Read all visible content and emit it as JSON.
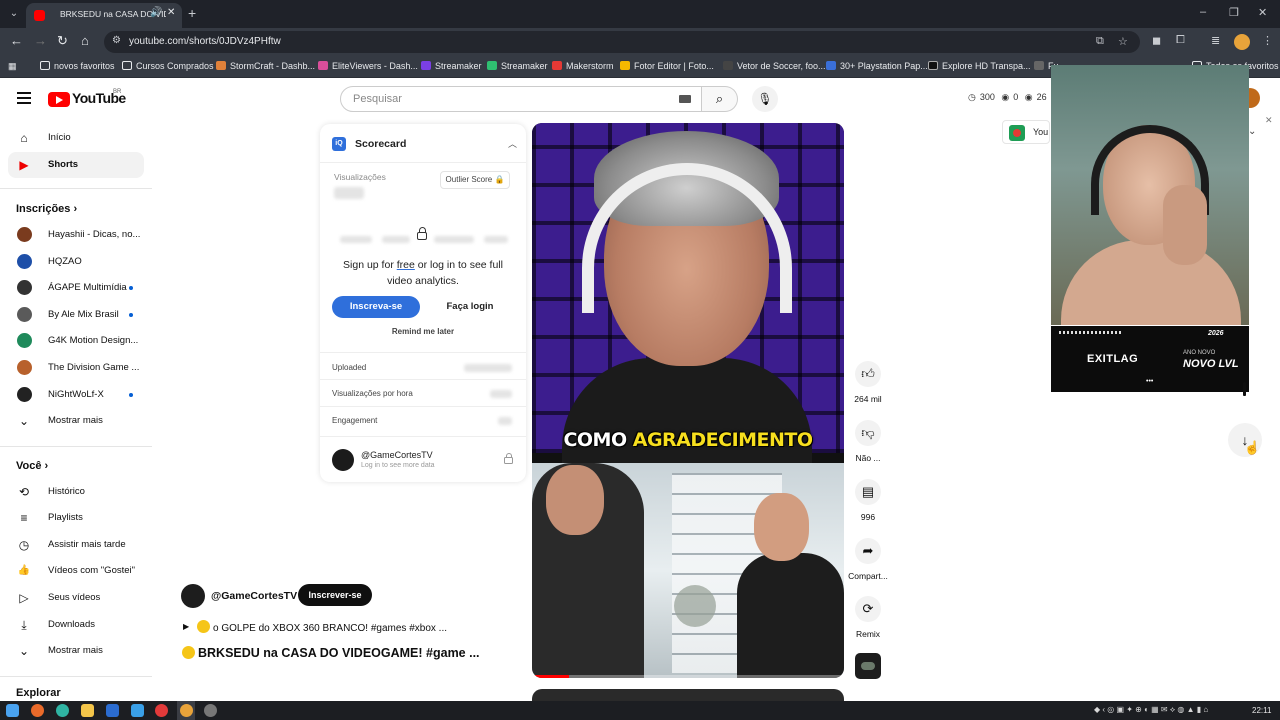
{
  "browser": {
    "tab_title": "BRKSEDU na CASA DO VIDEOGAME!",
    "url": "youtube.com/shorts/0JDVz4PHftw",
    "window_controls": [
      "–",
      "❐",
      "✕"
    ],
    "bookmarks": [
      {
        "label": "novos favoritos",
        "color": "#e8eaed"
      },
      {
        "label": "Cursos Comprados",
        "color": "#e8eaed"
      },
      {
        "label": "StormCraft - Dashb...",
        "color": "#e0813a"
      },
      {
        "label": "EliteViewers - Dash...",
        "color": "#d94e9a"
      },
      {
        "label": "Streamaker",
        "color": "#7b3fe4"
      },
      {
        "label": "Streamaker",
        "color": "#2fbf71"
      },
      {
        "label": "Makerstorm",
        "color": "#e53935"
      },
      {
        "label": "Fotor Editor | Foto...",
        "color": "#f5b800"
      },
      {
        "label": "Vetor de Soccer, foo...",
        "color": "#444444"
      },
      {
        "label": "30+ Playstation Pap...",
        "color": "#3a6fd8"
      },
      {
        "label": "Explore HD Transpa...",
        "color": "#111111"
      },
      {
        "label": "Fu...",
        "color": "#666666"
      },
      {
        "label": "Todos os favoritos",
        "color": "#e8eaed"
      }
    ]
  },
  "masthead": {
    "logo_text": "YouTube",
    "region": "BR",
    "search_placeholder": "Pesquisar",
    "ext_stats": [
      "300",
      "0",
      "26"
    ],
    "ext_widget_label": "You"
  },
  "sidebar": {
    "main": [
      {
        "label": "Início",
        "icon": "home-icon",
        "glyph": "⌂"
      },
      {
        "label": "Shorts",
        "icon": "shorts-icon",
        "glyph": "▶"
      }
    ],
    "subs_heading": "Inscrições",
    "subscriptions": [
      {
        "label": "Hayashii - Dicas, no...",
        "color": "#7a3b1e",
        "dot": false
      },
      {
        "label": "HQZAO",
        "color": "#1e4fa8",
        "dot": false
      },
      {
        "label": "ÁGAPE Multimídia",
        "color": "#333333",
        "dot": true
      },
      {
        "label": "By Ale Mix Brasil",
        "color": "#5a5a5a",
        "dot": true
      },
      {
        "label": "G4K Motion Design...",
        "color": "#1f8a5b",
        "dot": false
      },
      {
        "label": "The Division Game ...",
        "color": "#b8612c",
        "dot": false
      },
      {
        "label": "NiGhtWoLf-X",
        "color": "#222222",
        "dot": true
      }
    ],
    "show_more": "Mostrar mais",
    "you_heading": "Você",
    "you_items": [
      {
        "label": "Histórico",
        "icon": "history-icon",
        "glyph": "⟲"
      },
      {
        "label": "Playlists",
        "icon": "playlists-icon",
        "glyph": "≡"
      },
      {
        "label": "Assistir mais tarde",
        "icon": "watch-later-icon",
        "glyph": "◷"
      },
      {
        "label": "Vídeos com \"Gostei\"",
        "icon": "liked-icon",
        "glyph": "👍"
      },
      {
        "label": "Seus vídeos",
        "icon": "your-videos-icon",
        "glyph": "▷"
      },
      {
        "label": "Downloads",
        "icon": "downloads-icon",
        "glyph": "⤓"
      }
    ],
    "show_more_2": "Mostrar mais",
    "explore_heading": "Explorar"
  },
  "scorecard": {
    "title": "Scorecard",
    "views_label": "Visualizações",
    "outlier_label": "Outlier Score",
    "signup_prefix": "Sign up for ",
    "signup_free": "free",
    "signup_suffix": " or log in to see full video analytics.",
    "subscribe_btn": "Inscreva-se",
    "login_btn": "Faça login",
    "remind": "Remind me later",
    "uploaded_label": "Uploaded",
    "views_hour_label": "Visualizações por hora",
    "engagement_label": "Engagement",
    "channel_name": "@GameCortesTV",
    "channel_sub": "Log in to see more data"
  },
  "video": {
    "caption_a": "COMO ",
    "caption_b": "AGRADECIMENTO",
    "channel": "@GameCortesTV",
    "subscribe": "Inscrever-se",
    "description": "o GOLPE do XBOX 360 BRANCO! #games #xbox ...",
    "title": "BRKSEDU na CASA DO VIDEOGAME! #game ...",
    "progress": 0.12
  },
  "actions": {
    "like_count": "264 mil",
    "dislike_label": "Não ...",
    "comments_count": "996",
    "share_label": "Compart...",
    "remix_label": "Remix"
  },
  "overlay": {
    "banner_year": "2026",
    "banner_brand": "EXITLAG",
    "banner_top": "ANO NOVO",
    "banner_main": "NOVO LVL"
  },
  "taskbar": {
    "clock": "22:11"
  }
}
